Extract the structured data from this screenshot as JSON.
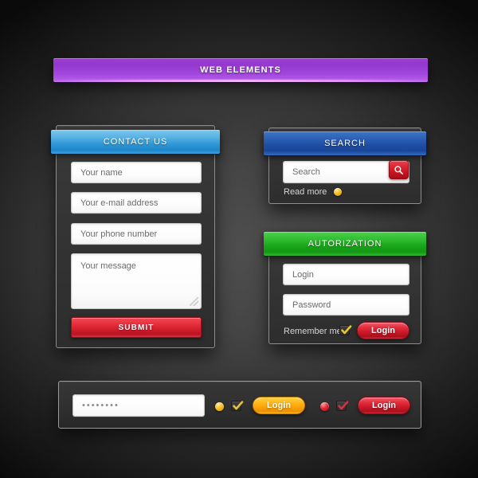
{
  "banner": {
    "title": "WEB ELEMENTS",
    "color": "#a045dd"
  },
  "contact_panel": {
    "header": "CONTACT US",
    "header_color": "#2f97d6",
    "fields": [
      {
        "name": "name",
        "placeholder": "Your name"
      },
      {
        "name": "email",
        "placeholder": "Your e-mail address"
      },
      {
        "name": "phone",
        "placeholder": "Your phone number"
      }
    ],
    "message_placeholder": "Your message",
    "submit_label": "SUBMIT",
    "submit_color": "#d41f2d"
  },
  "search_panel": {
    "header": "SEARCH",
    "header_color": "#1f4fa5",
    "input_placeholder": "Search",
    "search_icon": "magnifier-icon",
    "search_button_color": "#c4121f",
    "read_more_label": "Read more",
    "read_more_bullet": "yellow-bullet-icon",
    "bullet_color": "#f5c021"
  },
  "auth_panel": {
    "header": "AUTORIZATION",
    "header_color": "#19a519",
    "login_placeholder": "Login",
    "password_placeholder": "Password",
    "remember_label": "Remember me",
    "checkbox_icon": "check-icon",
    "checkbox_color": "#e8c434",
    "login_label": "Login",
    "login_color": "#cf1b2a"
  },
  "bottom_bar": {
    "password_value": "••••••••",
    "items": [
      {
        "bullet": "yellow-bullet-icon",
        "bullet_color": "#f5c021",
        "checkbox_icon": "check-icon",
        "checkbox_color": "#e8c434",
        "button_label": "Login",
        "button_color": "#fca70d"
      },
      {
        "bullet": "red-bullet-icon",
        "bullet_color": "#e22733",
        "checkbox_icon": "check-icon",
        "checkbox_color": "#d8303c",
        "button_label": "Login",
        "button_color": "#cf1b2a"
      }
    ]
  }
}
